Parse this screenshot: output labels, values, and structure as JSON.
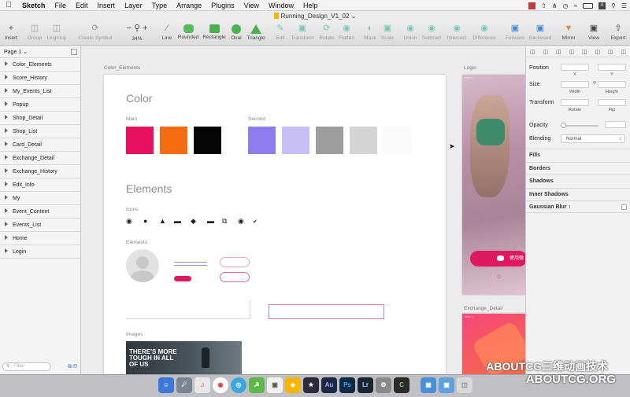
{
  "menubar": {
    "items": [
      "Sketch",
      "File",
      "Edit",
      "Insert",
      "Layer",
      "Type",
      "Arrange",
      "Plugins",
      "View",
      "Window",
      "Help"
    ]
  },
  "window": {
    "title": "Running_Design_V1_02"
  },
  "toolbar": {
    "insert": "Insert",
    "group": "Group",
    "ungroup": "Ungroup",
    "create_symbol": "Create Symbol",
    "zoom": "34%",
    "line": "Line",
    "rounded": "Rounded",
    "rectangle": "Rectangle",
    "oval": "Oval",
    "triangle": "Triangle",
    "edit": "Edit",
    "transform": "Transform",
    "rotate": "Rotate",
    "flatten": "Flatten",
    "mask": "Mask",
    "scale": "Scale",
    "union": "Union",
    "subtract": "Subtract",
    "intersect": "Intersect",
    "difference": "Difference",
    "forward": "Forward",
    "backward": "Backward",
    "mirror": "Mirror",
    "view": "View",
    "export": "Export"
  },
  "layers": {
    "page": "Page 1",
    "items": [
      "Color_Elements",
      "Score_History",
      "My_Events_List",
      "Popup",
      "Shop_Detail",
      "Shop_List",
      "Card_Detail",
      "Exchange_Detail",
      "Exchange_History",
      "Edit_Info",
      "My",
      "Event_Content",
      "Events_List",
      "Home",
      "Login"
    ],
    "filter_placeholder": "Filter"
  },
  "canvas": {
    "artboard_main_label": "Color_Elements",
    "artboard_login_label": "Login",
    "artboard_exchange_label": "Exchange_Detail",
    "color_title": "Color",
    "main_label": "Main",
    "second_label": "Second",
    "elements_title": "Elements",
    "icons_label": "Icons",
    "elements_label": "Elements",
    "images_label": "Images",
    "image_text": "THERE'S MORE TOUGH IN ALL OF US",
    "main_colors": [
      "#e8115f",
      "#f46b10",
      "#050505"
    ],
    "second_colors": [
      "#8f7cf0",
      "#c8bff7",
      "#9d9d9d",
      "#d4d4d4",
      "#fafafa"
    ],
    "login_button": "使用微"
  },
  "inspector": {
    "position": "Position",
    "x": "X",
    "y": "Y",
    "size": "Size",
    "width": "Width",
    "height": "Height",
    "transform": "Transform",
    "rotate": "Rotate",
    "flip": "Flip",
    "opacity": "Opacity",
    "blending": "Blending",
    "blending_value": "Normal",
    "fills": "Fills",
    "borders": "Borders",
    "shadows": "Shadows",
    "inner_shadows": "Inner Shadows",
    "gaussian_blur": "Gaussian Blur"
  },
  "watermark": {
    "line1": "ABOUTCG三维动画技术",
    "line2": "ABOUTCG.ORG"
  }
}
